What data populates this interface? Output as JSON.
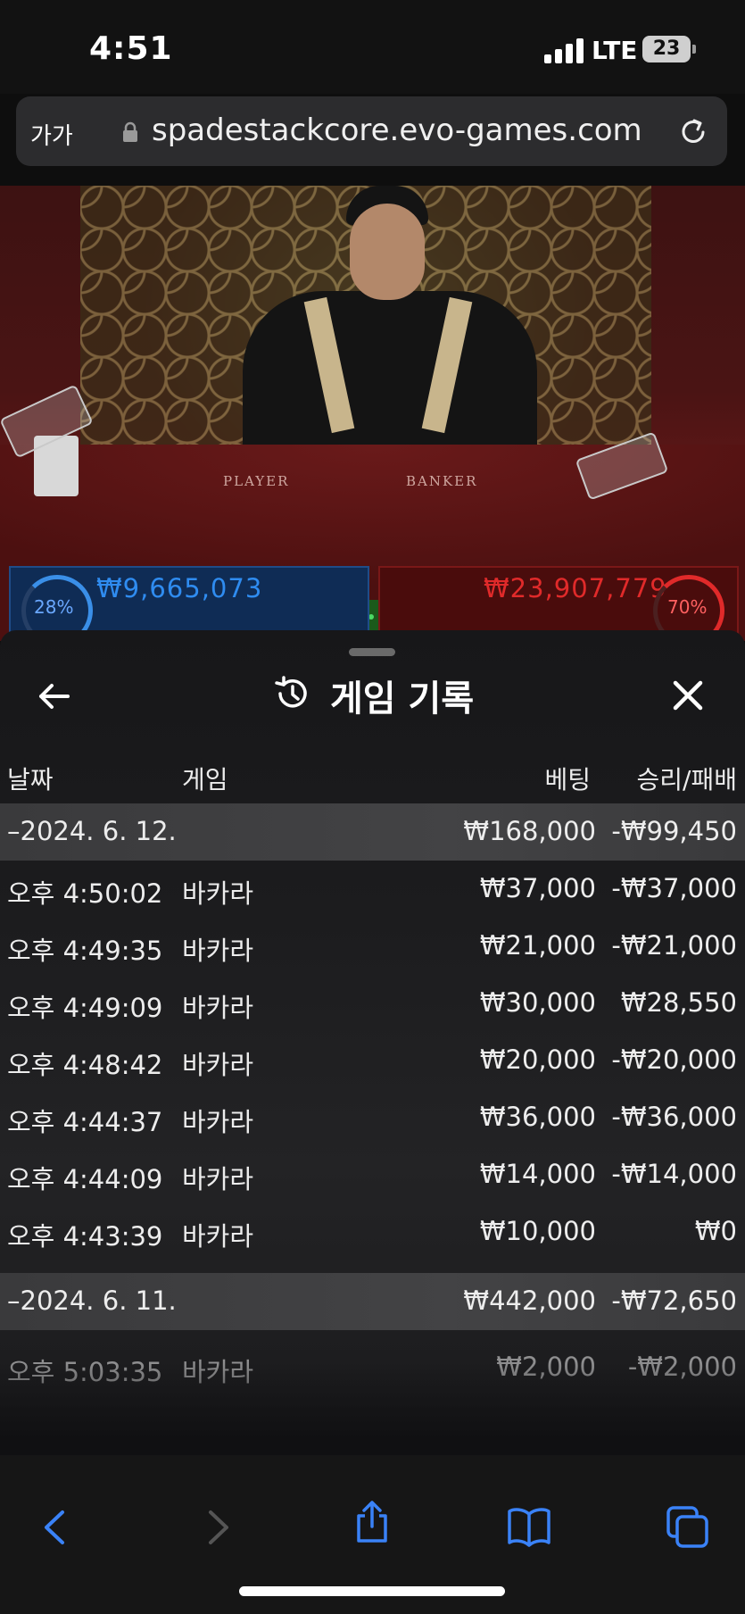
{
  "status_bar": {
    "time": "4:51",
    "network": "LTE",
    "battery": "23"
  },
  "browser": {
    "text_size": "가가",
    "url": "spadestackcore.evo-games.com"
  },
  "video": {
    "felt_labels": [
      "PLAYER",
      "BANKER"
    ],
    "player_pct": "28%",
    "player_amount": "₩9,665,073",
    "banker_pct": "70%",
    "banker_amount": "₩23,907,779"
  },
  "sheet": {
    "title": "게임 기록",
    "columns": [
      "날짜",
      "게임",
      "베팅",
      "승리/패배"
    ],
    "groups": [
      {
        "date": "–2024. 6. 12.",
        "bet_total": "₩168,000",
        "result_total": "-₩99,450",
        "rows": [
          {
            "time": "오후 4:50:02",
            "game": "바카라",
            "bet": "₩37,000",
            "result": "-₩37,000"
          },
          {
            "time": "오후 4:49:35",
            "game": "바카라",
            "bet": "₩21,000",
            "result": "-₩21,000"
          },
          {
            "time": "오후 4:49:09",
            "game": "바카라",
            "bet": "₩30,000",
            "result": "₩28,550"
          },
          {
            "time": "오후 4:48:42",
            "game": "바카라",
            "bet": "₩20,000",
            "result": "-₩20,000"
          },
          {
            "time": "오후 4:44:37",
            "game": "바카라",
            "bet": "₩36,000",
            "result": "-₩36,000"
          },
          {
            "time": "오후 4:44:09",
            "game": "바카라",
            "bet": "₩14,000",
            "result": "-₩14,000"
          },
          {
            "time": "오후 4:43:39",
            "game": "바카라",
            "bet": "₩10,000",
            "result": "₩0"
          }
        ]
      },
      {
        "date": "–2024. 6. 11.",
        "bet_total": "₩442,000",
        "result_total": "-₩72,650",
        "rows": [
          {
            "time": "오후 5:03:35",
            "game": "바카라",
            "bet": "₩2,000",
            "result": "-₩2,000"
          }
        ]
      }
    ]
  },
  "icons": {
    "back": "arrow-left-icon",
    "history": "history-icon",
    "close": "close-icon",
    "toolbar": [
      "chevron-left-icon",
      "chevron-right-icon",
      "share-icon",
      "bookmarks-icon",
      "tabs-icon"
    ]
  },
  "colors": {
    "accent": "#3a82f7",
    "player": "#1f4c88",
    "banker": "#7a1818"
  }
}
